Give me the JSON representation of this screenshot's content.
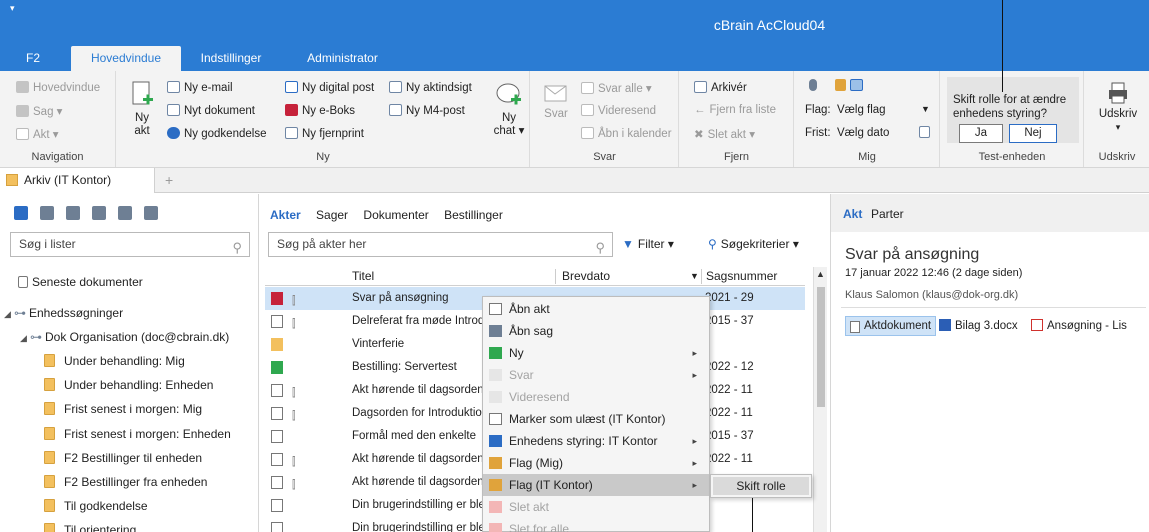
{
  "app": {
    "title": "cBrain AcCloud04",
    "sysmenu": "▾"
  },
  "ribbon_tabs": [
    "F2",
    "Hovedvindue",
    "Indstillinger",
    "Administrator"
  ],
  "navigation": {
    "label": "Navigation",
    "items": [
      "Hovedvindue",
      "Sag ▾",
      "Akt ▾"
    ]
  },
  "ny": {
    "label": "Ny",
    "big_label_line1": "Ny",
    "big_label_line2": "akt",
    "col1": [
      "Ny e-mail",
      "Nyt dokument",
      "Ny godkendelse"
    ],
    "col2": [
      "Ny digital post",
      "Ny e-Boks",
      "Ny fjernprint"
    ],
    "col3": [
      "Ny aktindsigt",
      "Ny M4-post"
    ],
    "chat_line1": "Ny",
    "chat_line2": "chat ▾"
  },
  "svar": {
    "label": "Svar",
    "big": "Svar",
    "items": [
      "Svar alle ▾",
      "Videresend",
      "Åbn i kalender"
    ]
  },
  "fjern": {
    "label": "Fjern",
    "items": [
      "Arkivér",
      "Fjern fra liste",
      "Slet akt ▾"
    ]
  },
  "mig": {
    "label": "Mig",
    "flag_label": "Flag:",
    "flag_value": "Vælg flag",
    "frist_label": "Frist:",
    "frist_value": "Vælg dato"
  },
  "test": {
    "label": "Test-enheden",
    "question": "Skift rolle for at ændre enhedens styring?",
    "yes": "Ja",
    "no": "Nej"
  },
  "udskriv": {
    "label": "Udskriv",
    "big": "Udskriv"
  },
  "doc_tab": {
    "title": "Arkiv (IT Kontor)",
    "plus": "+"
  },
  "left": {
    "search_placeholder": "Søg i lister",
    "recent": "Seneste dokumenter",
    "root": "Enhedssøgninger",
    "org": "Dok Organisation (doc@cbrain.dk)",
    "folders": [
      "Under behandling: Mig",
      "Under behandling: Enheden",
      "Frist senest i morgen: Mig",
      "Frist senest i morgen: Enheden",
      "F2 Bestillinger til enheden",
      "F2 Bestillinger fra enheden",
      "Til godkendelse",
      "Til orientering"
    ]
  },
  "middle": {
    "tabs": [
      "Akter",
      "Sager",
      "Dokumenter",
      "Bestillinger"
    ],
    "search_placeholder": "Søg på akter her",
    "filter": "Filter ▾",
    "criteria": "Søgekriterier ▾",
    "columns": {
      "title": "Titel",
      "date": "Brevdato",
      "case": "Sagsnummer"
    },
    "rows": [
      {
        "title": "Svar på ansøgning",
        "case": "2021 - 29"
      },
      {
        "title": "Delreferat fra møde Introduktion",
        "case": "2015 - 37"
      },
      {
        "title": "Vinterferie",
        "case": ""
      },
      {
        "title": "Bestilling: Servertest",
        "case": "2022 - 12"
      },
      {
        "title": "Akt hørende til dagsordenen",
        "case": "2022 - 11"
      },
      {
        "title": "Dagsorden for Introduktion",
        "case": "2022 - 11"
      },
      {
        "title": "Formål med den enkelte",
        "case": "2015 - 37"
      },
      {
        "title": "Akt hørende til dagsordenen",
        "case": "2022 - 11"
      },
      {
        "title": "Akt hørende til dagsordenen",
        "case": "2022 - 11"
      },
      {
        "title": "Din brugerindstilling er blevet",
        "case": ""
      },
      {
        "title": "Din brugerindstilling er blevet",
        "case": ""
      }
    ]
  },
  "context_menu": {
    "items": [
      "Åbn akt",
      "Åbn sag",
      "Ny",
      "Svar",
      "Videresend",
      "Marker som ulæst (IT Kontor)",
      "Enhedens styring: IT Kontor",
      "Flag (Mig)",
      "Flag (IT Kontor)",
      "Slet akt",
      "Slet for alle"
    ],
    "submenu": "Skift rolle"
  },
  "right": {
    "tabs": [
      "Akt",
      "Parter"
    ],
    "title": "Svar på ansøgning",
    "date": "17 januar 2022 12:46 (2 dage siden)",
    "sender": "Klaus Salomon (klaus@dok-org.dk)",
    "attachments": [
      "Aktdokument",
      "Bilag 3.docx",
      "Ansøgning - Lis"
    ]
  },
  "colors": {
    "accent": "#2b7cd3",
    "selection": "#cfe3f7",
    "folder": "#f3c05e"
  }
}
